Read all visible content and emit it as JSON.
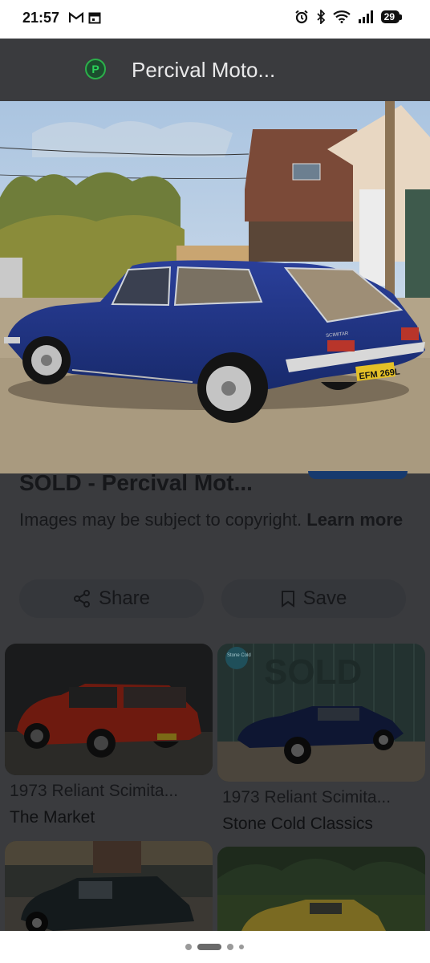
{
  "status": {
    "time": "21:57",
    "battery": "29"
  },
  "header": {
    "logo_letter": "P",
    "title": "Percival Moto..."
  },
  "photo": {
    "plate": "EFM 269L",
    "badge": "SCIMITAR"
  },
  "result": {
    "title": "SOLD - Percival Mot...",
    "copyright_text": "Images may be subject to copyright.",
    "learn_more": "Learn more"
  },
  "actions": {
    "share": "Share",
    "save": "Save"
  },
  "related": [
    {
      "title": "1973 Reliant Scimita...",
      "source": "The Market"
    },
    {
      "title": "1973 Reliant Scimita...",
      "source": "Stone Cold Classics",
      "overlay": "SOLD",
      "logo_text": "Stone Cold"
    }
  ]
}
